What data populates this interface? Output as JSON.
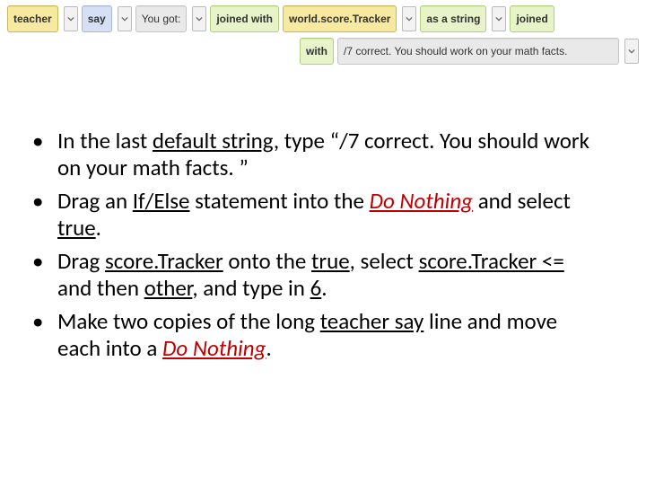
{
  "code": {
    "row1": {
      "teacher": "teacher",
      "say": "say",
      "youGot": "You got:",
      "joined1": "joined with",
      "world": "world.score.Tracker",
      "asString": "as a string",
      "joinedEnd": "joined"
    },
    "row2": {
      "with": "with",
      "tail": "/7 correct. You should work on your math facts."
    }
  },
  "bul": {
    "b1": {
      "a": "In the last ",
      "b": "default string",
      "c": ", type “/7 correct. You should work on your math facts. ”"
    },
    "b2": {
      "a": "Drag an ",
      "b": "If/Else",
      "c": " statement into the ",
      "d": "Do Nothing",
      "e": " and select ",
      "f": "true",
      "g": "."
    },
    "b3": {
      "a": "Drag ",
      "b": "score.Tracker",
      "c": " onto the ",
      "d": "true",
      "e": ", select ",
      "f": "score.Tracker <=",
      "g": " and then ",
      "h": "other",
      "i": ", and type in ",
      "j": "6",
      "k": "."
    },
    "b4": {
      "a": "Make two copies of the long ",
      "b": "teacher say",
      "c": " line and move each into a ",
      "d": "Do Nothing",
      "e": "."
    }
  }
}
